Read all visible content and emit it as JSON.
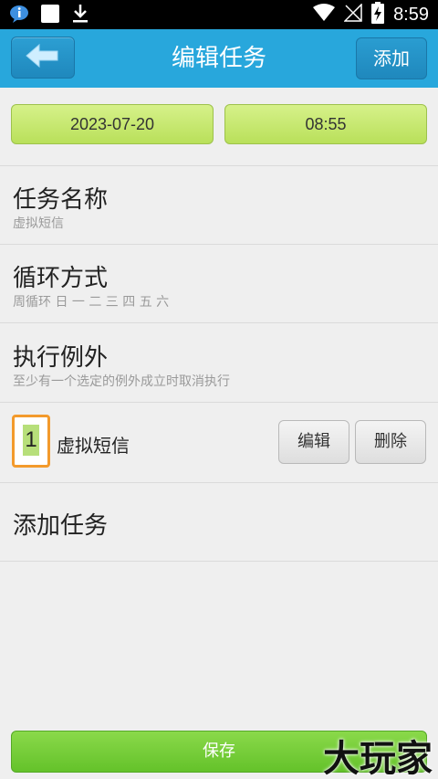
{
  "status_bar": {
    "time": "8:59",
    "icons": [
      "notification-icon",
      "square-icon",
      "download-icon",
      "wifi-icon",
      "no-signal-icon",
      "battery-charging-icon"
    ]
  },
  "header": {
    "title": "编辑任务",
    "add_label": "添加",
    "back_icon": "back-arrow-icon"
  },
  "schedule": {
    "date": "2023-07-20",
    "time": "08:55"
  },
  "sections": {
    "task_name": {
      "title": "任务名称",
      "subtitle": "虚拟短信"
    },
    "repeat": {
      "title": "循环方式",
      "subtitle": "周循环 日 一 二 三 四 五 六"
    },
    "exceptions": {
      "title": "执行例外",
      "subtitle": "至少有一个选定的例外成立时取消执行"
    }
  },
  "tasks": [
    {
      "index": "1",
      "name": "虚拟短信",
      "edit_label": "编辑",
      "delete_label": "删除"
    }
  ],
  "add_task_label": "添加任务",
  "save_label": "保存",
  "watermark": "大玩家",
  "colors": {
    "header": "#28a7dc",
    "date_button": "#c8e86f",
    "save_button": "#6ccb32",
    "index_border": "#f39a2c"
  }
}
